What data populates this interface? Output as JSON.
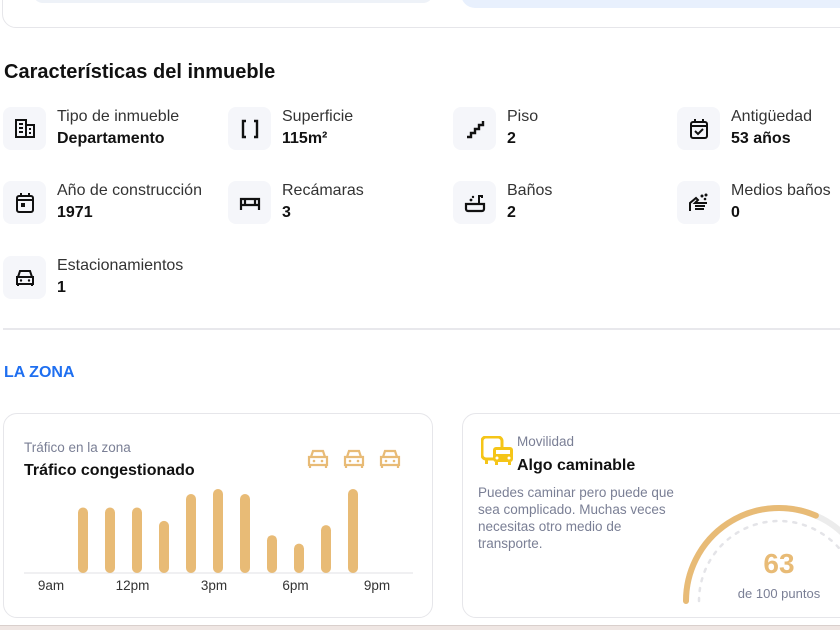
{
  "section_title": "Características del inmueble",
  "features": [
    {
      "icon": "building-icon",
      "label": "Tipo de inmueble",
      "value": "Departamento"
    },
    {
      "icon": "area-icon",
      "label": "Superficie",
      "value": "115m²"
    },
    {
      "icon": "stairs-icon",
      "label": "Piso",
      "value": "2"
    },
    {
      "icon": "calendar-check-icon",
      "label": "Antigüedad",
      "value": "53 años"
    },
    {
      "icon": "calendar-icon",
      "label": "Año de construcción",
      "value": "1971"
    },
    {
      "icon": "bed-icon",
      "label": "Recámaras",
      "value": "3"
    },
    {
      "icon": "bathtub-icon",
      "label": "Baños",
      "value": "2"
    },
    {
      "icon": "hand-wash-icon",
      "label": "Medios baños",
      "value": "0"
    },
    {
      "icon": "car-icon",
      "label": "Estacionamientos",
      "value": "1"
    }
  ],
  "zona_title": "LA ZONA",
  "traffic": {
    "subtitle": "Tráfico en la zona",
    "title": "Tráfico congestionado",
    "level_icons": 3,
    "color": "#e8bb76",
    "chart_data": {
      "type": "bar",
      "x_ticks": [
        "9am",
        "12pm",
        "3pm",
        "6pm",
        "9pm"
      ],
      "categories": [
        "10am",
        "11am",
        "12pm",
        "1pm",
        "2pm",
        "3pm",
        "4pm",
        "5pm",
        "6pm",
        "7pm",
        "8pm"
      ],
      "values": [
        78,
        78,
        78,
        62,
        94,
        100,
        94,
        45,
        35,
        57,
        100
      ],
      "ylim": [
        0,
        100
      ]
    }
  },
  "mobility": {
    "subtitle": "Movilidad",
    "title": "Algo caminable",
    "description": "Puedes caminar pero puede que sea complicado. Muchas veces necesitas otro medio de transporte.",
    "score": "63",
    "score_value": 63,
    "score_caption": "de 100 puntos",
    "icon_color": "#f5c518",
    "gauge_color": "#e8bb76"
  }
}
